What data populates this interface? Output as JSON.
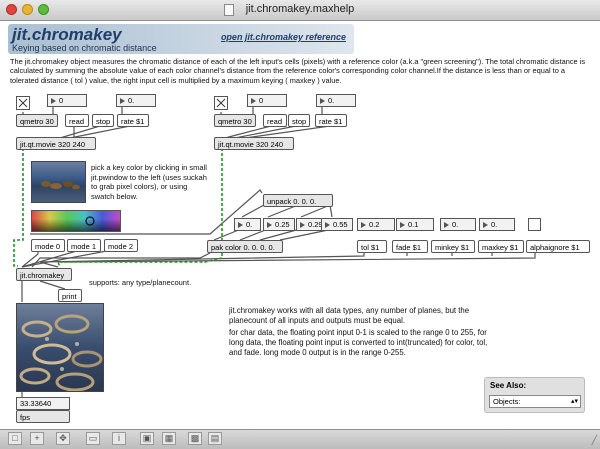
{
  "window": {
    "title": "jit.chromakey.maxhelp"
  },
  "header": {
    "name": "jit.chromakey",
    "subtitle": "Keying based on chromatic distance",
    "reference_link": "open jit.chromakey reference"
  },
  "description": "The jit.chromakey object measures the chromatic distance of each of the left input's cells (pixels) with a reference color (a.k.a \"green screening\"). The total chromatic distance is calculated by summing the absolute value of each color channel's distance from the reference color's corresponding color channel.If the distance is less than or equal to a tolerated distance ( tol ) value, the right input cell is multiplied by a maximum keying ( maxkey ) value.",
  "left_movie": {
    "rate_number": "0.",
    "num_left": "0",
    "metro": "qmetro 30",
    "read": "read",
    "stop": "stop",
    "rate": "rate $1",
    "movie": "jit.qt.movie 320 240"
  },
  "right_movie": {
    "rate_number": "0.",
    "num_left": "0",
    "metro": "qmetro 30",
    "read": "read",
    "stop": "stop",
    "rate": "rate $1",
    "movie": "jit.qt.movie 320 240"
  },
  "key_note": "pick a key color by clicking in small jit.pwindow to the left (uses suckah to grab pixel colors), or using swatch below.",
  "modes": [
    "mode 0",
    "mode 1",
    "mode 2"
  ],
  "unpack": "unpack 0. 0. 0.",
  "color_numbers": [
    "0.",
    "0.25",
    "0.29",
    "0.55"
  ],
  "pak": "pak color 0. 0. 0. 0.",
  "params": {
    "tol_value": "0.2",
    "tol": "tol $1",
    "fade_value": "0.1",
    "fade": "fade $1",
    "minkey_value": "0.",
    "minkey": "minkey $1",
    "maxkey_value": "0.",
    "maxkey": "maxkey $1",
    "alphaignore": "alphaignore $1"
  },
  "chromakey": "jit.chromakey",
  "print": "print",
  "support_note": "supports: any type/planecount.",
  "info1": "jit.chromakey works with all data types, any number of planes, but the planecount of all inputs and outputs must be equal.",
  "info2": "for char data, the floating point input 0-1 is scaled to the range 0 to 255, for long data, the floating point input is converted to int(truncated) for color, tol, and fade. long mode 0 output is in the range 0-255.",
  "fps_value": "33.33640",
  "fps_label": "fps",
  "see_also": {
    "label": "See Also:",
    "selected": "Objects:"
  },
  "colors": {
    "patch_cord": "#2a8f2a",
    "header": "#a9bfd2"
  }
}
